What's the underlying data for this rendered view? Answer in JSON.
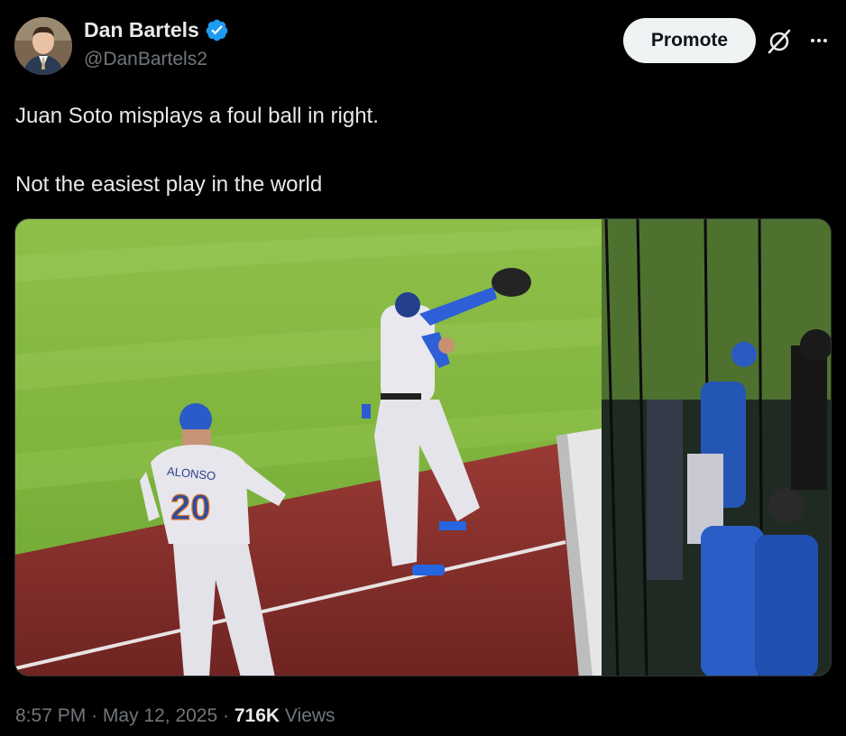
{
  "author": {
    "name": "Dan Bartels",
    "handle": "@DanBartels2",
    "verified": true
  },
  "actions": {
    "promote_label": "Promote",
    "grok_icon": "grok-slash-icon",
    "more_icon": "more-dots-icon"
  },
  "tweet": {
    "line1": "Juan Soto misplays a foul ball in right.",
    "line2": "Not the easiest play in the world"
  },
  "media": {
    "jersey_name": "ALONSO",
    "jersey_number": "20"
  },
  "meta": {
    "time": "8:57 PM",
    "separator": "·",
    "date": "May 12, 2025",
    "views_count": "716K",
    "views_label": "Views"
  },
  "colors": {
    "verified": "#1d9bf0",
    "text": "#e7e9ea",
    "muted": "#71767b",
    "promote_bg": "#eff3f4"
  }
}
